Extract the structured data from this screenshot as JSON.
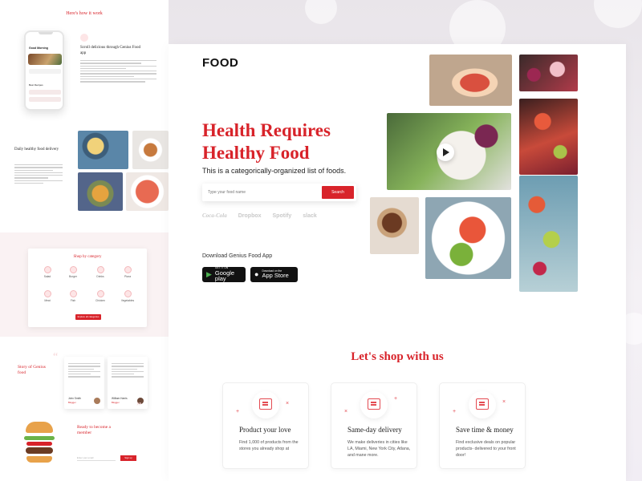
{
  "left_panel": {
    "how_title": "Here's how it work",
    "phone": {
      "greeting": "Good Morning",
      "recipes_label": "Best Recipes"
    },
    "step1_title": "Scroll delicious through Genius Food app",
    "step2_title": "Daily healthy food delivery",
    "shop_by_category": "Shop by category",
    "categories": [
      "Salad",
      "Burger",
      "Drinks",
      "Pizza",
      "Meat",
      "Fish",
      "Chicken",
      "Vegetables"
    ],
    "explore_button": "Explore all categories",
    "story_title": "Story of Genius food",
    "reviewers": [
      {
        "name": "John Smith",
        "role": "Blogger"
      },
      {
        "name": "William Harris",
        "role": "Blogger"
      }
    ],
    "member_title": "Ready to become a member",
    "member_placeholder": "Enter your email",
    "member_button": "Sign up"
  },
  "header": {
    "logo": "FOOD"
  },
  "hero": {
    "title": "Health Requires Healthy Food",
    "subtitle": "This is a categorically-organized list of foods.",
    "search_placeholder": "Type your food name",
    "search_button": "Search",
    "brands": [
      "Coca-Cola",
      "Dropbox",
      "Spotify",
      "slack"
    ],
    "download_label": "Download Genius Food  App",
    "google_play": {
      "small": "GET IT ON",
      "large": "Google play"
    },
    "app_store": {
      "small": "Download on the",
      "large": "App Store"
    }
  },
  "shop_section": {
    "title": "Let's shop with us",
    "features": [
      {
        "icon": "cake-icon",
        "title": "Product your love",
        "desc": "Find 1,000 of products from the stores you already shop at"
      },
      {
        "icon": "delivery-icon",
        "title": "Same-day delivery",
        "desc": "We make deliveries in cities like LA, Miami, New York City, Atlana, and mane more."
      },
      {
        "icon": "deal-icon",
        "title": "Save time & money",
        "desc": "Find exclusive deals on popular products- delivered to your front door!"
      }
    ]
  },
  "colors": {
    "brand_red": "#d8232a",
    "text_dark": "#222222"
  }
}
